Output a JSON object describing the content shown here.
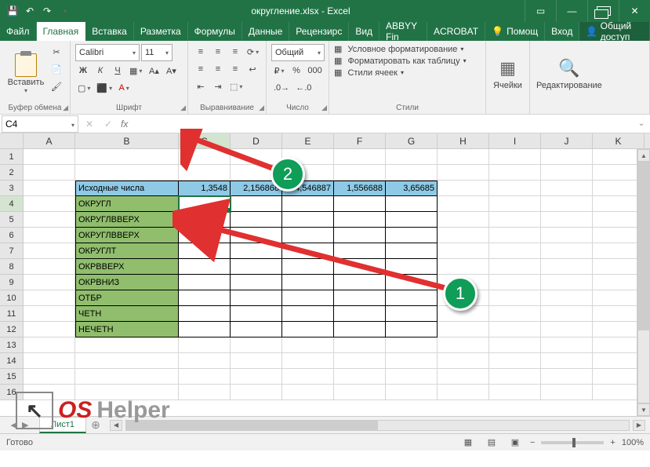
{
  "titlebar": {
    "doc_title": "округление.xlsx - Excel"
  },
  "tabs": {
    "file": "Файл",
    "home": "Главная",
    "insert": "Вставка",
    "layout": "Разметка",
    "formulas": "Формулы",
    "data": "Данные",
    "review": "Рецензирc",
    "view": "Вид",
    "abbyy": "ABBYY Fin",
    "acrobat": "ACROBAT",
    "tell": "Помощ",
    "signin": "Вход",
    "share": "Общий доступ"
  },
  "ribbon": {
    "clipboard": {
      "label": "Буфер обмена",
      "paste": "Вставить"
    },
    "font": {
      "label": "Шрифт",
      "name": "Calibri",
      "size": "11",
      "bold": "Ж",
      "italic": "К",
      "underline": "Ч"
    },
    "align": {
      "label": "Выравнивание"
    },
    "number": {
      "label": "Число",
      "format": "Общий"
    },
    "styles": {
      "label": "Стили",
      "cond": "Условное форматирование",
      "table": "Форматировать как таблицу",
      "cell": "Стили ячеек"
    },
    "cells": {
      "label": "Ячейки"
    },
    "editing": {
      "label": "Редактирование"
    }
  },
  "namebox": {
    "ref": "C4"
  },
  "columns": [
    "A",
    "B",
    "C",
    "D",
    "E",
    "F",
    "G",
    "H",
    "I",
    "J",
    "K"
  ],
  "rows_visible": 16,
  "table": {
    "header_label": "Исходные числа",
    "values": [
      "1,3548",
      "2,156868",
      "4,546887",
      "1,556688",
      "3,65685"
    ],
    "func_rows": [
      "ОКРУГЛ",
      "ОКРУГЛВВЕРХ",
      "ОКРУГЛВВЕРХ",
      "ОКРУГЛТ",
      "ОКРВВЕРХ",
      "ОКРВНИЗ",
      "ОТБР",
      "ЧЕТН",
      "НЕЧЕТН"
    ]
  },
  "sheets": {
    "active": "Лист1"
  },
  "status": {
    "ready": "Готово",
    "zoom": "100%"
  },
  "annotations": {
    "b1": "1",
    "b2": "2"
  },
  "watermark": {
    "os": "OS",
    "helper": "Helper"
  }
}
